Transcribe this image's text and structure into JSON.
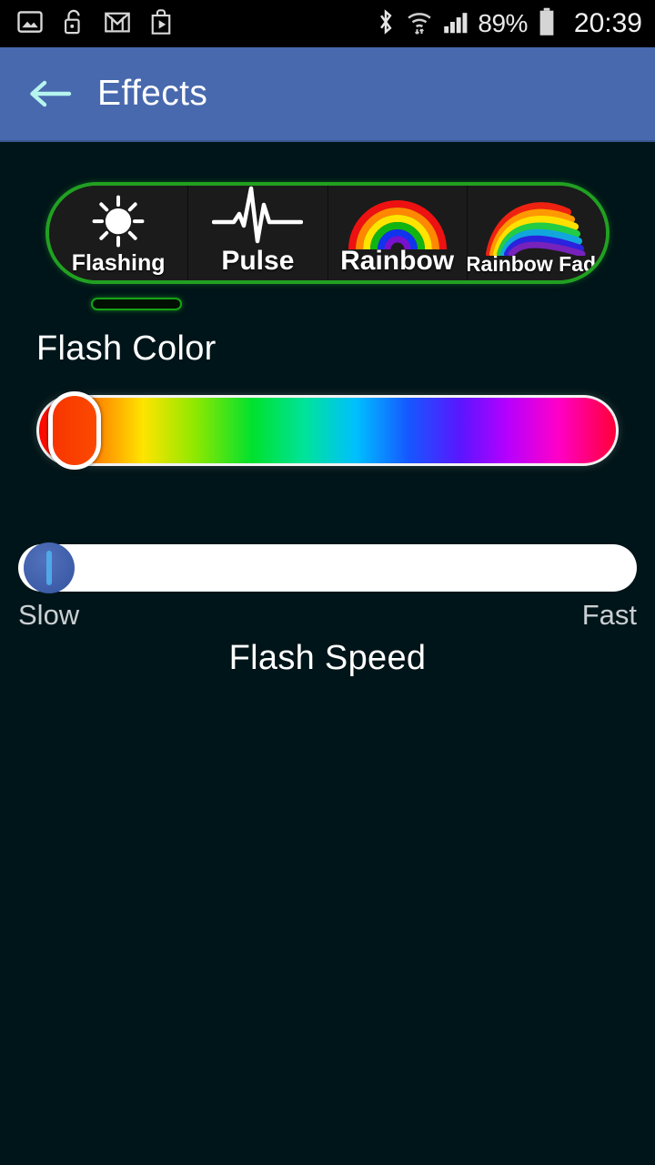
{
  "status_bar": {
    "left_icons": [
      {
        "name": "image-icon",
        "label": "Screenshot"
      },
      {
        "name": "unlock-icon",
        "label": "Unlocked"
      },
      {
        "name": "gmail-icon",
        "label": "Gmail"
      },
      {
        "name": "play-store-icon",
        "label": "Play Store"
      }
    ],
    "right_icons": [
      {
        "name": "bluetooth-icon",
        "label": "Bluetooth"
      },
      {
        "name": "wifi-icon",
        "label": "Wi-Fi"
      },
      {
        "name": "cell-signal-icon",
        "label": "Signal"
      }
    ],
    "battery_percent": "89%",
    "battery_icon": "battery-icon",
    "clock": "20:39"
  },
  "header": {
    "back_icon": "back-arrow-icon",
    "title": "Effects",
    "color": "#4869ae"
  },
  "tabs": {
    "selected_index": 0,
    "accent_color": "#21a021",
    "items": [
      {
        "label": "Flashing",
        "icon": "sun-flash-icon"
      },
      {
        "label": "Pulse",
        "icon": "pulse-waveform-icon"
      },
      {
        "label": "Rainbow",
        "icon": "rainbow-arc-icon"
      },
      {
        "label": "Rainbow Fade",
        "icon": "rainbow-fade-icon"
      }
    ]
  },
  "flash_color": {
    "label": "Flash Color",
    "slider_name": "flash-color-slider",
    "thumb_position_percent": 4,
    "selected_color": "#f94000"
  },
  "flash_speed": {
    "label": "Flash Speed",
    "slider_name": "flash-speed-slider",
    "min_label": "Slow",
    "max_label": "Fast",
    "thumb_position_percent": 1,
    "thumb_color": "#3d5da8"
  }
}
